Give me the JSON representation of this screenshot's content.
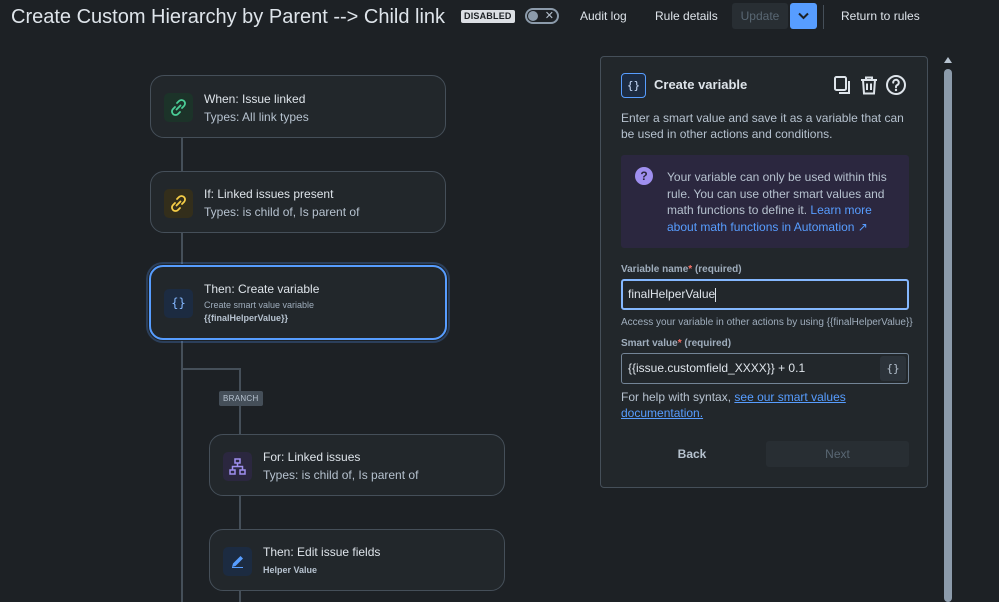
{
  "header": {
    "title": "Create Custom Hierarchy by Parent --> Child link",
    "status_badge": "DISABLED",
    "audit_log": "Audit log",
    "rule_details": "Rule details",
    "update": "Update",
    "return_to_rules": "Return to rules"
  },
  "flow": {
    "trigger": {
      "line1": "When: Issue linked",
      "line2": "Types: All link types"
    },
    "condition": {
      "line1": "If: Linked issues present",
      "line2": "Types: is child of, Is parent of"
    },
    "action": {
      "line1": "Then: Create variable",
      "line2": "Create smart value variable",
      "line3": "{{finalHelperValue}}"
    },
    "branch_label": "BRANCH",
    "branch": {
      "line1": "For: Linked issues",
      "line2": "Types: is child of, Is parent of"
    },
    "edit": {
      "line1": "Then: Edit issue fields",
      "line2": "Helper Value"
    }
  },
  "panel": {
    "title": "Create variable",
    "icon_glyph": "{}",
    "description": "Enter a smart value and save it as a variable that can be used in other actions and conditions.",
    "note_icon": "?",
    "note_text": "Your variable can only be used within this rule. You can use other smart values and math functions to define it. ",
    "note_link": "Learn more about math functions in Automation ↗",
    "var_name_label": "Variable name",
    "required_mark": "*",
    "required_text": "(required)",
    "var_name_value": "finalHelperValue",
    "var_name_help": "Access your variable in other actions by using {{finalHelperValue}}",
    "smart_value_label": "Smart value",
    "smart_value_value": "{{issue.customfield_XXXX}} + 0.1",
    "insert_glyph": "{}",
    "syntax_text": "For help with syntax, ",
    "syntax_link": "see our smart values documentation.",
    "back": "Back",
    "next": "Next"
  },
  "colors": {
    "background": "#1d2125",
    "card": "#22272b",
    "accent": "#579dff",
    "note_bg": "#2b273f",
    "trigger_icon": "#4bce97",
    "condition_icon": "#f5cd47",
    "branch_icon": "#9f8fef"
  },
  "icons": {
    "trigger": "link-icon",
    "condition": "link-icon",
    "action": "curly-braces-icon",
    "branch": "hierarchy-icon",
    "edit": "pencil-icon",
    "copy": "copy-icon",
    "delete": "trash-icon",
    "help": "help-icon"
  }
}
